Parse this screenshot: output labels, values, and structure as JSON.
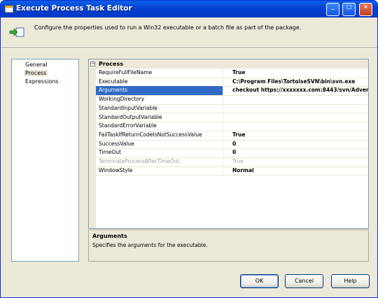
{
  "window": {
    "title": "Execute Process Task Editor",
    "buttons": {
      "minimize": "_",
      "maximize": "□",
      "close": "×"
    }
  },
  "header": {
    "icon": "process-arrow-icon",
    "text": "Configure the properties used to run a Win32 executable or a batch file as part of the package."
  },
  "nav": {
    "items": [
      {
        "label": "General",
        "selected": false
      },
      {
        "label": "Process",
        "selected": true
      },
      {
        "label": "Expressions",
        "selected": false
      }
    ]
  },
  "grid": {
    "category": {
      "label": "Process",
      "toggle": "⊟"
    },
    "properties": [
      {
        "name": "RequireFullFileName",
        "value": "True"
      },
      {
        "name": "Executable",
        "value": "C:\\Program Files\\TortoiseSVN\\bin\\svn.exe"
      },
      {
        "name": "Arguments",
        "value": "checkout https://xxxxxxx.com:8443/svn/Adven"
      },
      {
        "name": "WorkingDirectory",
        "value": ""
      },
      {
        "name": "StandardInputVariable",
        "value": ""
      },
      {
        "name": "StandardOutputVariable",
        "value": ""
      },
      {
        "name": "StandardErrorVariable",
        "value": ""
      },
      {
        "name": "FailTaskIfReturnCodeIsNotSuccessValue",
        "value": "True"
      },
      {
        "name": "SuccessValue",
        "value": "0"
      },
      {
        "name": "TimeOut",
        "value": "0"
      },
      {
        "name": "TerminateProcessAfterTimeOut",
        "value": "True"
      },
      {
        "name": "WindowStyle",
        "value": "Normal"
      }
    ]
  },
  "description": {
    "title": "Arguments",
    "text": "Specifies the arguments for the executable."
  },
  "footer": {
    "ok": "OK",
    "cancel": "Cancel",
    "help": "Help"
  }
}
